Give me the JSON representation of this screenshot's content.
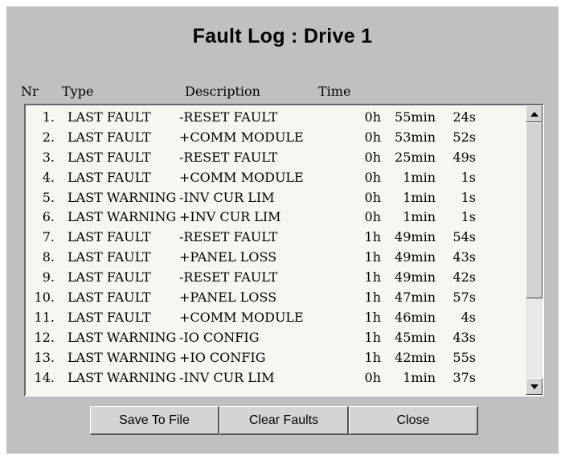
{
  "dialog": {
    "title": "Fault Log : Drive 1"
  },
  "columns": {
    "nr": "Nr",
    "type": "Type",
    "description": "Description",
    "time": "Time"
  },
  "rows": [
    {
      "nr": "1.",
      "type": "LAST FAULT",
      "desc": "-RESET FAULT",
      "h": "0h",
      "m": "55min",
      "s": "24s"
    },
    {
      "nr": "2.",
      "type": "LAST FAULT",
      "desc": "+COMM MODULE",
      "h": "0h",
      "m": "53min",
      "s": "52s"
    },
    {
      "nr": "3.",
      "type": "LAST FAULT",
      "desc": "-RESET FAULT",
      "h": "0h",
      "m": "25min",
      "s": "49s"
    },
    {
      "nr": "4.",
      "type": "LAST FAULT",
      "desc": "+COMM MODULE",
      "h": "0h",
      "m": "1min",
      "s": "1s"
    },
    {
      "nr": "5.",
      "type": "LAST WARNING",
      "desc": "-INV CUR LIM",
      "h": "0h",
      "m": "1min",
      "s": "1s"
    },
    {
      "nr": "6.",
      "type": "LAST WARNING",
      "desc": "+INV CUR LIM",
      "h": "0h",
      "m": "1min",
      "s": "1s"
    },
    {
      "nr": "7.",
      "type": "LAST FAULT",
      "desc": "-RESET FAULT",
      "h": "1h",
      "m": "49min",
      "s": "54s"
    },
    {
      "nr": "8.",
      "type": "LAST FAULT",
      "desc": "+PANEL LOSS",
      "h": "1h",
      "m": "49min",
      "s": "43s"
    },
    {
      "nr": "9.",
      "type": "LAST FAULT",
      "desc": "-RESET FAULT",
      "h": "1h",
      "m": "49min",
      "s": "42s"
    },
    {
      "nr": "10.",
      "type": "LAST FAULT",
      "desc": "+PANEL LOSS",
      "h": "1h",
      "m": "47min",
      "s": "57s"
    },
    {
      "nr": "11.",
      "type": "LAST FAULT",
      "desc": "+COMM MODULE",
      "h": "1h",
      "m": "46min",
      "s": "4s"
    },
    {
      "nr": "12.",
      "type": "LAST WARNING",
      "desc": "-IO CONFIG",
      "h": "1h",
      "m": "45min",
      "s": "43s"
    },
    {
      "nr": "13.",
      "type": "LAST WARNING",
      "desc": "+IO CONFIG",
      "h": "1h",
      "m": "42min",
      "s": "55s"
    },
    {
      "nr": "14.",
      "type": "LAST WARNING",
      "desc": "-INV CUR LIM",
      "h": "0h",
      "m": "1min",
      "s": "37s"
    }
  ],
  "buttons": {
    "save": "Save To File",
    "clear": "Clear Faults",
    "close": "Close"
  },
  "icons": {
    "scroll_up": "scroll-up-arrow-icon",
    "scroll_down": "scroll-down-arrow-icon"
  },
  "colors": {
    "dialog_bg": "#c0c0c0",
    "list_bg": "#f7f7f2"
  }
}
